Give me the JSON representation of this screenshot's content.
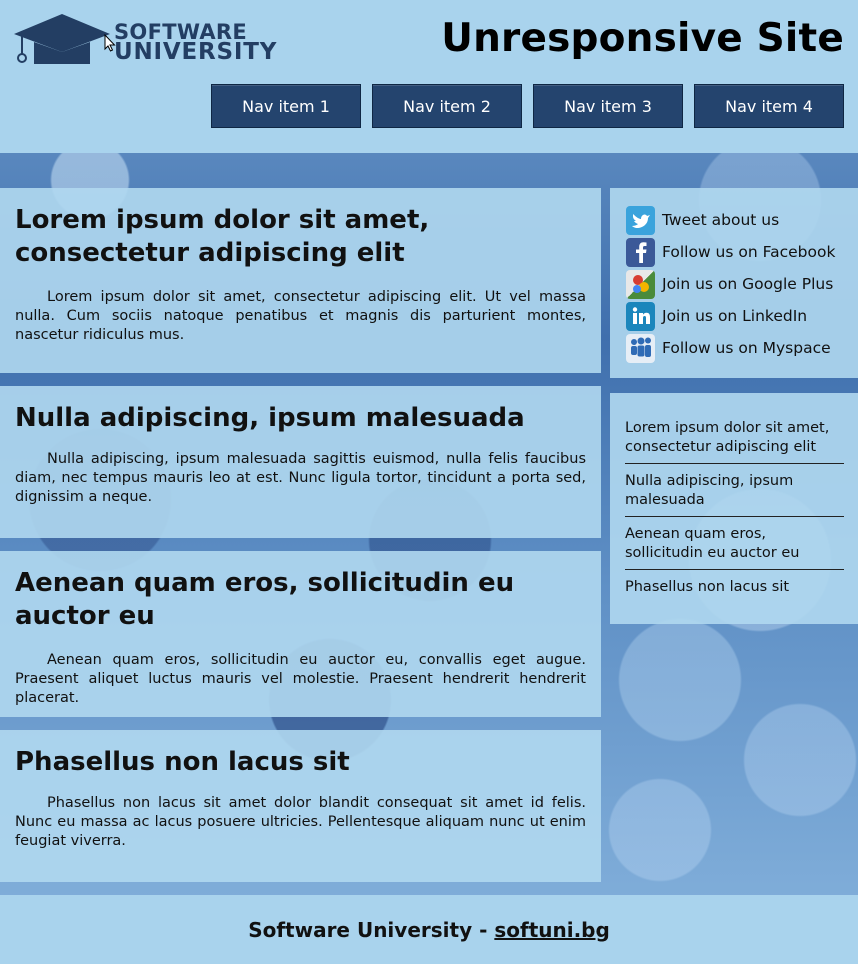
{
  "header": {
    "logo": {
      "line1": "SOFTWARE",
      "line2": "UNIVERSITY"
    },
    "title": "Unresponsive Site"
  },
  "nav": [
    {
      "label": "Nav item 1"
    },
    {
      "label": "Nav item 2"
    },
    {
      "label": "Nav item 3"
    },
    {
      "label": "Nav item 4"
    }
  ],
  "articles": [
    {
      "title": "Lorem ipsum dolor sit amet, consectetur adipiscing elit",
      "text": "Lorem ipsum dolor sit amet, consectetur adipiscing elit. Ut vel massa nulla. Cum sociis natoque penatibus et magnis dis parturient montes, nascetur ridiculus mus."
    },
    {
      "title": "Nulla adipiscing, ipsum malesuada",
      "text": "Nulla adipiscing, ipsum malesuada sagittis euismod, nulla felis faucibus diam, nec tempus mauris leo at est. Nunc ligula tortor, tincidunt a porta sed, dignissim a neque."
    },
    {
      "title": "Aenean quam eros, sollicitudin eu auctor eu",
      "text": "Aenean quam eros, sollicitudin eu auctor eu, convallis eget augue. Praesent aliquet luctus mauris vel molestie. Praesent hendrerit hendrerit placerat."
    },
    {
      "title": "Phasellus non lacus sit",
      "text": "Phasellus non lacus sit amet dolor blandit consequat sit amet id felis. Nunc eu massa ac lacus posuere ultricies. Pellentesque aliquam nunc ut enim feugiat viverra."
    }
  ],
  "social": [
    {
      "label": "Tweet about us",
      "icon": "twitter-icon",
      "color": "#3aa3dc"
    },
    {
      "label": "Follow us on Facebook",
      "icon": "facebook-icon",
      "color": "#3b5998"
    },
    {
      "label": "Join us on Google Plus",
      "icon": "google-plus-icon",
      "color": "#4a8b3b"
    },
    {
      "label": "Join us on LinkedIn",
      "icon": "linkedin-icon",
      "color": "#1b86bc"
    },
    {
      "label": "Follow us on Myspace",
      "icon": "myspace-icon",
      "color": "#2f6bb5"
    }
  ],
  "sidebar_links": [
    {
      "label": "Lorem ipsum dolor sit amet, consectetur adipiscing elit"
    },
    {
      "label": "Nulla adipiscing, ipsum malesuada"
    },
    {
      "label": "Aenean quam eros, sollicitudin eu auctor eu"
    },
    {
      "label": "Phasellus non lacus sit"
    }
  ],
  "footer": {
    "text": "Software University - ",
    "link": "softuni.bg"
  },
  "colors": {
    "header_bg": "#a9d3ed",
    "nav_bg": "#24446e",
    "logo_text": "#233e63"
  }
}
